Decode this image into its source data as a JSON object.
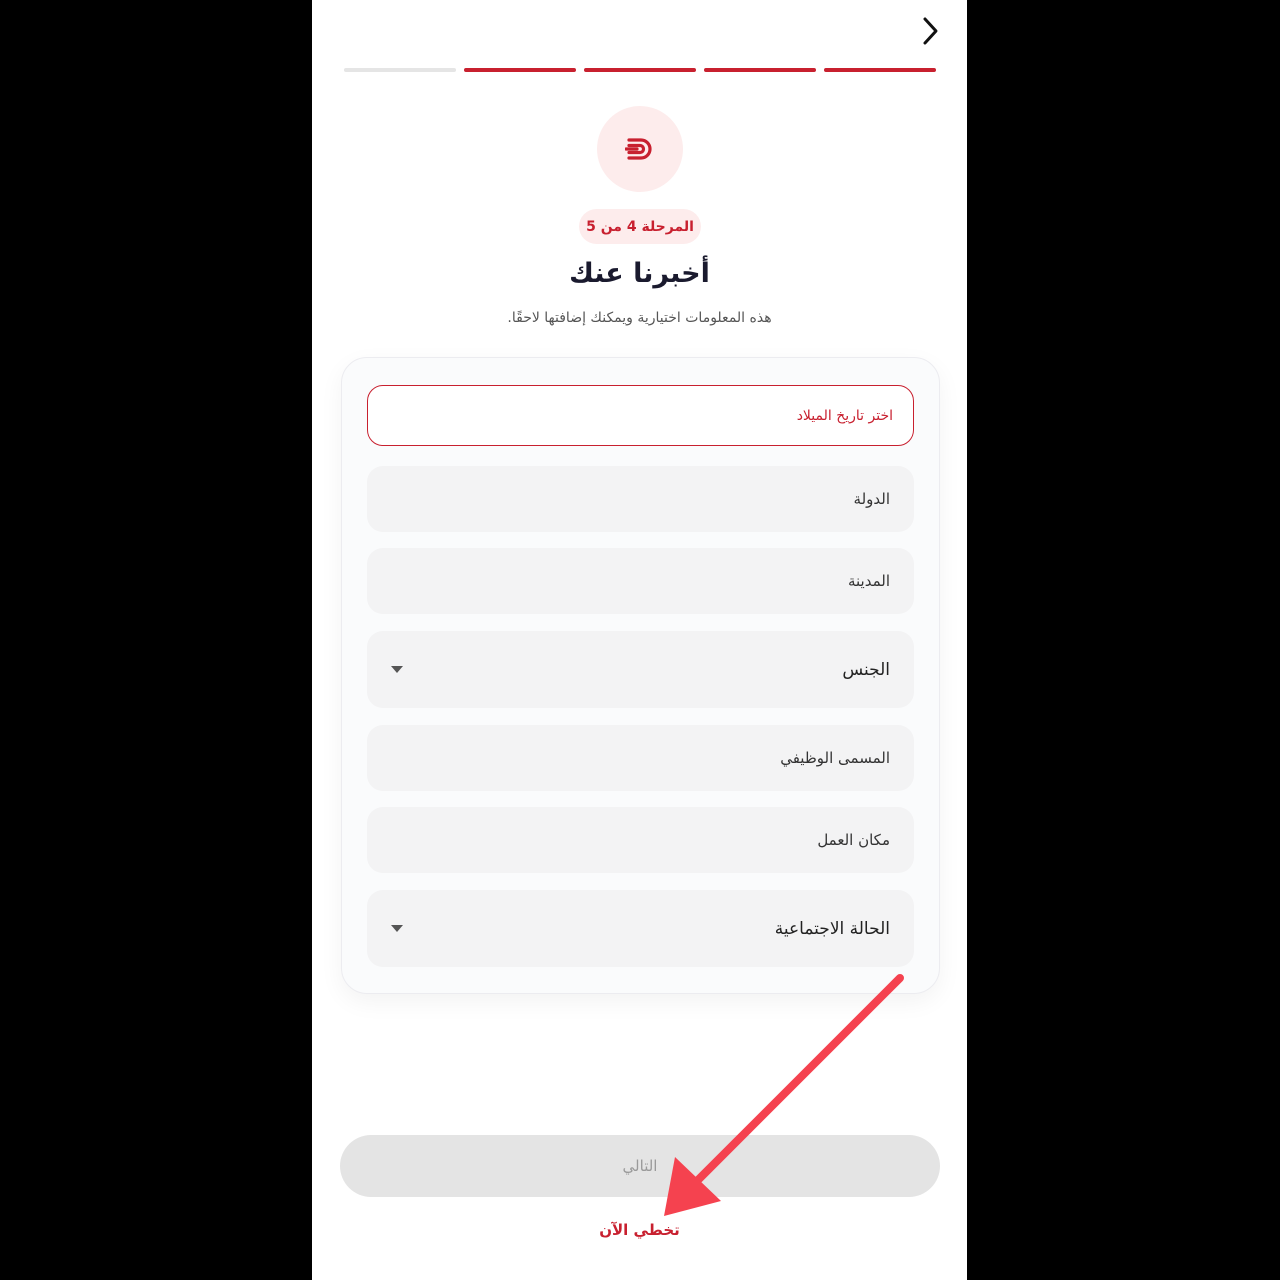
{
  "header": {
    "back_icon": "chevron-right-icon"
  },
  "progress": {
    "total_steps": 5,
    "completed_steps": 4
  },
  "logo": {
    "icon": "brand-logo-icon",
    "accent_color": "#c8202f",
    "bg_color": "#fdecec"
  },
  "step_badge": "المرحلة 4 من 5",
  "title": "أخبرنا عنك",
  "subtitle": "هذه المعلومات اختيارية ويمكنك إضافتها لاحقًا.",
  "form": {
    "birth_date_placeholder": "اختر تاريخ الميلاد",
    "country_placeholder": "الدولة",
    "city_placeholder": "المدينة",
    "gender_label": "الجنس",
    "job_title_placeholder": "المسمى الوظيفي",
    "workplace_placeholder": "مكان العمل",
    "marital_status_label": "الحالة الاجتماعية"
  },
  "actions": {
    "next_label": "التالي",
    "skip_label": "تخطي الآن"
  },
  "annotation": {
    "arrow_color": "#f5424f"
  }
}
